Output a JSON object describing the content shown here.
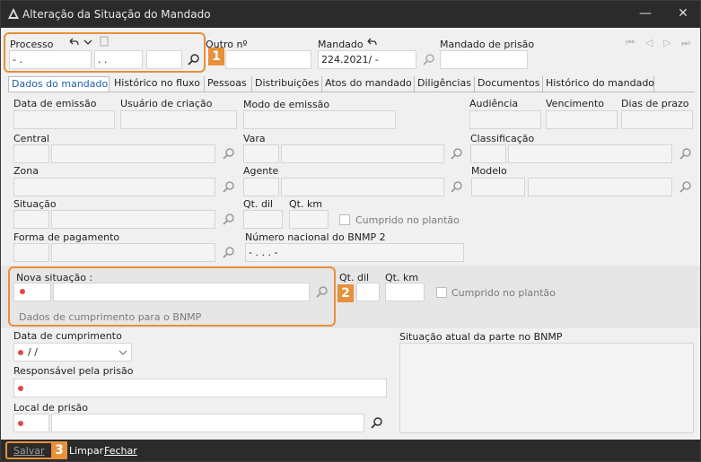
{
  "window": {
    "title": "Alteração da Situação do Mandado",
    "minimize": "—",
    "close": "✕"
  },
  "header": {
    "processo_label": "Processo",
    "processo_val1": "  -  .",
    "processo_val2": ". .",
    "processo_val3": "",
    "outro_label": "Outro nº",
    "mandado_label": "Mandado",
    "mandado_value": "224.2021/    -",
    "mandado_prisao_label": "Mandado de prisão",
    "nav": [
      "⏮",
      "◁",
      "▷",
      "⏭"
    ]
  },
  "tabs": [
    "Dados do mandado",
    "Histórico no fluxo",
    "Pessoas",
    "Distribuições",
    "Atos do mandado",
    "Diligências",
    "Documentos",
    "Histórico do mandado"
  ],
  "form": {
    "data_emissao": "Data de emissão",
    "usuario_criacao": "Usuário de criação",
    "modo_emissao": "Modo de emissão",
    "audiencia": "Audiência",
    "vencimento": "Vencimento",
    "dias_prazo": "Dias de prazo",
    "central": "Central",
    "vara": "Vara",
    "classificacao": "Classificação",
    "zona": "Zona",
    "agente": "Agente",
    "modelo": "Modelo",
    "situacao": "Situação",
    "qt_dil": "Qt. dil",
    "qt_km": "Qt. km",
    "cumprido_plantao": "Cumprido no plantão",
    "forma_pagamento": "Forma de pagamento",
    "numero_bnmp": "Número nacional do BNMP 2",
    "numero_bnmp_value": "   -  .  .   .   -"
  },
  "nova": {
    "label": "Nova situação :",
    "qt_dil": "Qt. dil",
    "qt_km": "Qt. km",
    "cumprido": "Cumprido no plantão",
    "dados_bnmp": "Dados de cumprimento para o BNMP"
  },
  "bnmp": {
    "data_cumprimento": "Data de cumprimento",
    "data_value": "/  /",
    "responsavel": "Responsável pela prisão",
    "local": "Local de prisão",
    "situacao_atual": "Situação atual da parte no BNMP"
  },
  "footer": {
    "salvar": "Salvar",
    "limpar": "Limpar",
    "fechar": "Fechar"
  },
  "badges": [
    "1",
    "2",
    "3"
  ],
  "colors": {
    "accent": "#e8903a",
    "required": "#e84646",
    "titlebar": "#2b2b2b",
    "tab_active": "#1f5fa8"
  }
}
